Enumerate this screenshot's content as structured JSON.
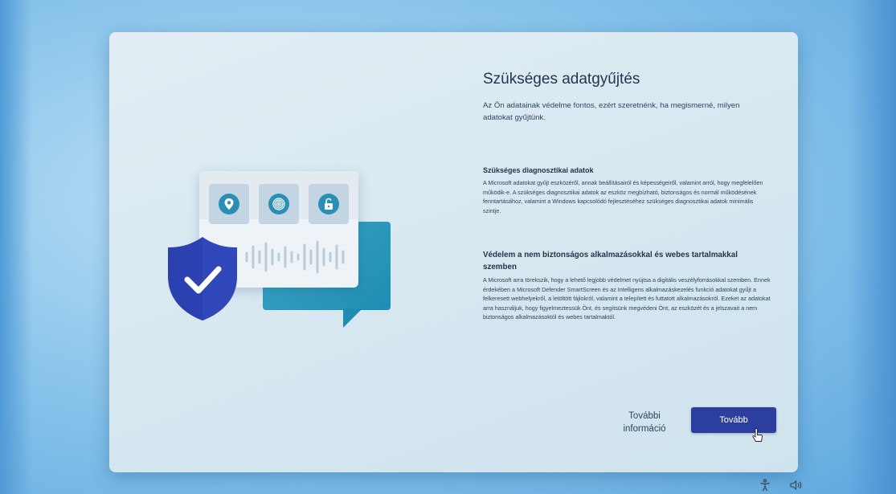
{
  "window": {
    "title": "Szükséges adatgyűjtés",
    "intro": "Az Ön adatainak védelme fontos, ezért szeretnénk, ha megismerné, milyen adatokat gyűjtünk."
  },
  "sections": [
    {
      "heading": "Szükséges diagnosztikai adatok",
      "body": "A Microsoft adatokat gyűjt eszközéről, annak beállításairól és képességeiről, valamint arról, hogy megfelelően működik-e. A szükséges diagnosztikai adatok az eszköz megbízható, biztonságos és normál működésének fenntartásához, valamint a Windows kapcsolódó fejlesztéséhez szükséges diagnosztikai adatok minimális szintje."
    },
    {
      "heading": "Védelem a nem biztonságos alkalmazásokkal és webes tartalmakkal szemben",
      "body": "A Microsoft arra törekszik, hogy a lehető legjobb védelmet nyújtsa a digitális veszélyforrásokkal szemben. Ennek érdekében a Microsoft Defender SmartScreen és az Intelligens alkalmazáskezelés funkció adatokat gyűjt a felkeresett webhelyekről, a letöltött fájlokról, valamint a telepített és futtatott alkalmazásokról. Ezeket az adatokat arra használjuk, hogy figyelmeztessük Önt, és segítsünk megvédeni Önt, az eszközét és a jelszavait a nem biztonságos alkalmazásoktól és webes tartalmaktól."
    }
  ],
  "buttons": {
    "more_info": "További információ",
    "next": "Tovább"
  },
  "illustration": {
    "icons": [
      "location-pin-icon",
      "fingerprint-icon",
      "unlock-icon",
      "shield-check-icon",
      "audio-waveform-icon"
    ]
  },
  "taskbar": {
    "icons": [
      "accessibility-icon",
      "volume-icon"
    ]
  },
  "colors": {
    "accent_button": "#2d3f9e",
    "shield": "#2b41b0",
    "teal": "#2b8fb5",
    "window_bg": "#dbeaf2"
  }
}
